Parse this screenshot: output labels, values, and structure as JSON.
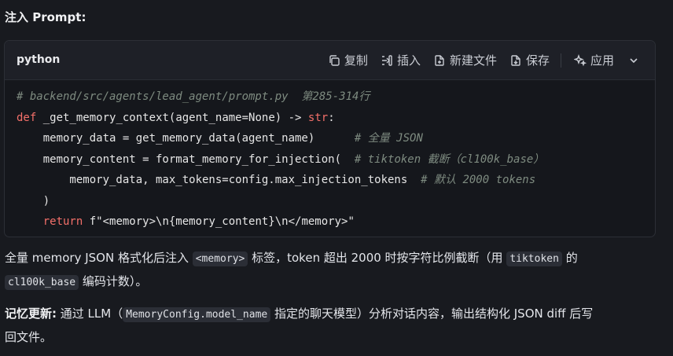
{
  "section_title": "注入 Prompt:",
  "code_block": {
    "language": "python",
    "actions": [
      {
        "label": "复制",
        "icon": "copy-icon"
      },
      {
        "label": "插入",
        "icon": "insert-icon"
      },
      {
        "label": "新建文件",
        "icon": "new-file-icon"
      },
      {
        "label": "保存",
        "icon": "save-icon"
      },
      {
        "label": "应用",
        "icon": "apply-sparkle-icon"
      }
    ],
    "lines": {
      "l1_comment": "# backend/src/agents/lead_agent/prompt.py  第285-314行",
      "l2_def": "def",
      "l2_fn": " _get_memory_context(",
      "l2_param": "agent_name=None",
      "l2_arrow": ") -> ",
      "l2_type": "str",
      "l2_end": ":",
      "l3_code": "    memory_data = get_memory_data(agent_name)      ",
      "l3_comment": "# 全量 JSON",
      "l4_code": "    memory_content = format_memory_for_injection(  ",
      "l4_comment": "# tiktoken 截断（cl100k_base）",
      "l5_code": "        memory_data, max_tokens=config.max_injection_tokens  ",
      "l5_comment": "# 默认 2000 tokens",
      "l6_code": "    )",
      "l7_kw": "    return",
      "l7_code": " f\"<memory>\\n{memory_content}\\n</memory>\""
    }
  },
  "para1": {
    "t1": "全量 memory JSON 格式化后注入 ",
    "code1": "<memory>",
    "t2": " 标签，token 超出 2000 时按字符比例截断（用 ",
    "code2": "tiktoken",
    "t3": " 的",
    "code3": "cl100k_base",
    "t4": " 编码计数）。"
  },
  "para2": {
    "bold": "记忆更新:",
    "t1": " 通过 LLM（",
    "code1": "MemoryConfig.model_name",
    "t2": " 指定的聊天模型）分析对话内容，输出结构化 JSON diff 后写",
    "t3": "回文件。"
  }
}
